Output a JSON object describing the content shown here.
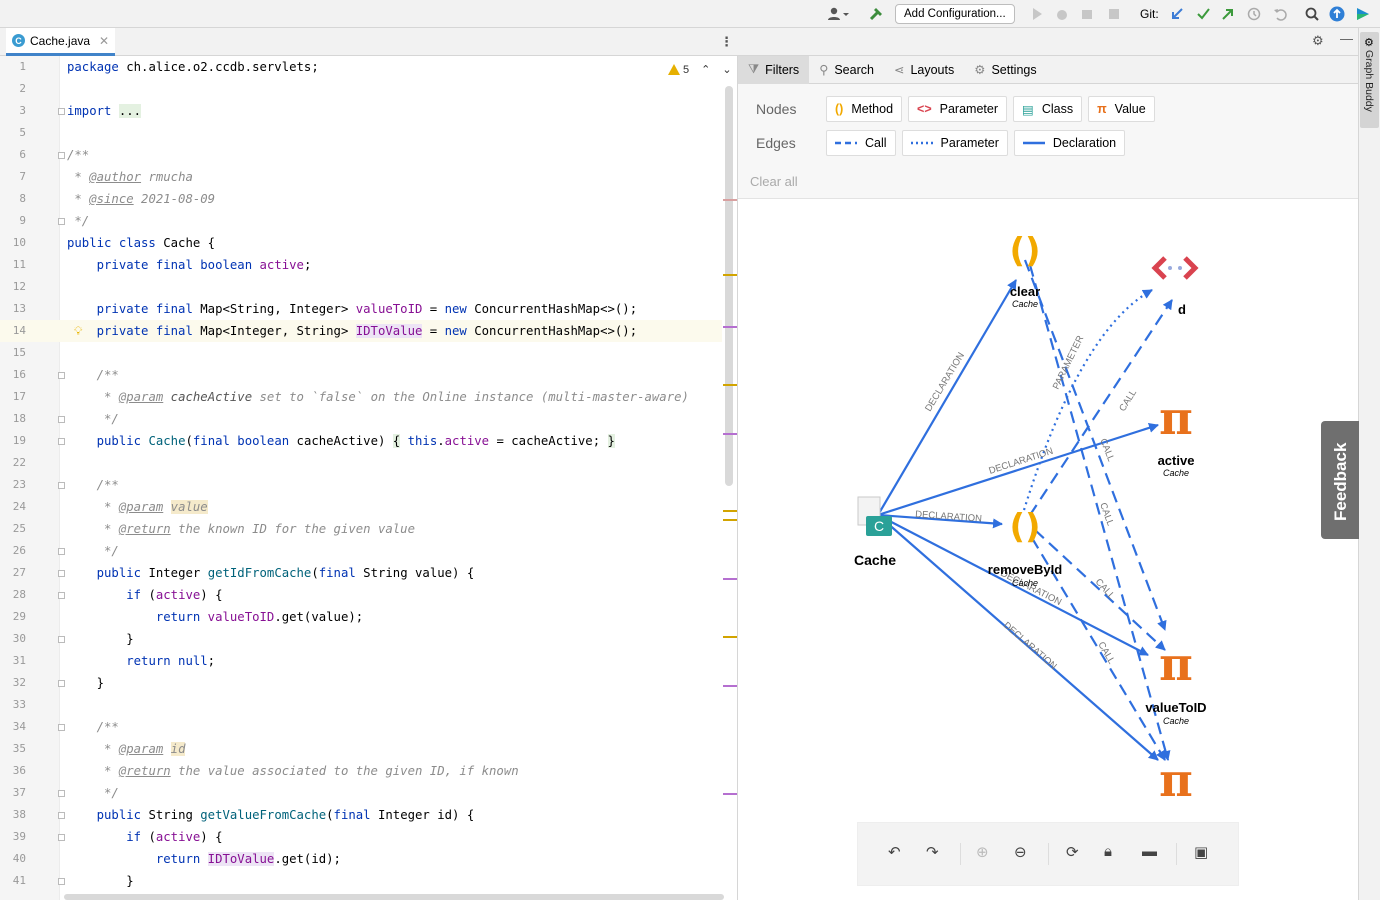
{
  "toolbar": {
    "add_config": "Add Configuration...",
    "git_label": "Git:"
  },
  "editor": {
    "tab_label": "Cache.java",
    "warning_count": "5",
    "lines": [
      {
        "n": "1",
        "html": "<span class=\"kw\">package</span> ch.alice.o2.ccdb.servlets;"
      },
      {
        "n": "2",
        "html": ""
      },
      {
        "n": "3",
        "html": "<span class=\"kw\">import</span> <span style=\"background:#e4f1e1\">...</span>"
      },
      {
        "n": "5",
        "html": ""
      },
      {
        "n": "6",
        "html": "<span class=\"cm\">/**</span>"
      },
      {
        "n": "7",
        "html": "<span class=\"cm\"> * <span class=\"tag\">@author</span> rmucha</span>"
      },
      {
        "n": "8",
        "html": "<span class=\"cm\"> * <span class=\"tag\">@since</span> 2021-08-09</span>"
      },
      {
        "n": "9",
        "html": "<span class=\"cm\"> */</span>"
      },
      {
        "n": "10",
        "html": "<span class=\"kw\">public class</span> Cache {"
      },
      {
        "n": "11",
        "html": "    <span class=\"kw\">private final boolean</span> <span class=\"fld\">active</span>;"
      },
      {
        "n": "12",
        "html": ""
      },
      {
        "n": "13",
        "html": "    <span class=\"kw\">private final</span> Map&lt;String, Integer&gt; <span class=\"fld\">valueToID</span> = <span class=\"kw\">new</span> ConcurrentHashMap&lt;&gt;();"
      },
      {
        "n": "14",
        "html": "    <span class=\"kw\">private final</span> Map&lt;Integer, String&gt; <span class=\"fld\" style=\"background:#ede4f5\">IDToValue</span> = <span class=\"kw\">new</span> ConcurrentHashMap&lt;&gt;();"
      },
      {
        "n": "15",
        "html": ""
      },
      {
        "n": "16",
        "html": "    <span class=\"cm\">/**</span>"
      },
      {
        "n": "17",
        "html": "    <span class=\"cm\"> * <span class=\"tag\">@param</span> <span style=\"color:#555\">cacheActive</span> set to `false` on the Online instance (multi-master-aware)</span>"
      },
      {
        "n": "18",
        "html": "    <span class=\"cm\"> */</span>"
      },
      {
        "n": "19",
        "html": "    <span class=\"kw\">public</span> <span class=\"fn\">Cache</span>(<span class=\"kw\">final boolean</span> cacheActive) <span style=\"background:#e4f1e1\">{</span> <span class=\"kw\">this</span>.<span class=\"fld\">active</span> = cacheActive; <span style=\"background:#e4f1e1\">}</span>"
      },
      {
        "n": "22",
        "html": ""
      },
      {
        "n": "23",
        "html": "    <span class=\"cm\">/**</span>"
      },
      {
        "n": "24",
        "html": "    <span class=\"cm\"> * <span class=\"tag\">@param</span> <span class=\"pm\">value</span></span>"
      },
      {
        "n": "25",
        "html": "    <span class=\"cm\"> * <span class=\"tag\">@return</span> the known ID for the given value</span>"
      },
      {
        "n": "26",
        "html": "    <span class=\"cm\"> */</span>"
      },
      {
        "n": "27",
        "html": "    <span class=\"kw\">public</span> Integer <span class=\"fn\">getIdFromCache</span>(<span class=\"kw\">final</span> String value) {"
      },
      {
        "n": "28",
        "html": "        <span class=\"kw\">if</span> (<span class=\"fld\">active</span>) {"
      },
      {
        "n": "29",
        "html": "            <span class=\"kw\">return</span> <span class=\"fld\">valueToID</span>.get(value);"
      },
      {
        "n": "30",
        "html": "        }"
      },
      {
        "n": "31",
        "html": "        <span class=\"kw\">return null</span>;"
      },
      {
        "n": "32",
        "html": "    }"
      },
      {
        "n": "33",
        "html": ""
      },
      {
        "n": "34",
        "html": "    <span class=\"cm\">/**</span>"
      },
      {
        "n": "35",
        "html": "    <span class=\"cm\"> * <span class=\"tag\">@param</span> <span class=\"pm\">id</span></span>"
      },
      {
        "n": "36",
        "html": "    <span class=\"cm\"> * <span class=\"tag\">@return</span> the value associated to the given ID, if known</span>"
      },
      {
        "n": "37",
        "html": "    <span class=\"cm\"> */</span>"
      },
      {
        "n": "38",
        "html": "    <span class=\"kw\">public</span> String <span class=\"fn\">getValueFromCache</span>(<span class=\"kw\">final</span> Integer id) {"
      },
      {
        "n": "39",
        "html": "        <span class=\"kw\">if</span> (<span class=\"fld\">active</span>) {"
      },
      {
        "n": "40",
        "html": "            <span class=\"kw\">return</span> <span class=\"fld\" style=\"background:#ede4f5\">IDToValue</span>.get(id);"
      },
      {
        "n": "41",
        "html": "        }"
      }
    ]
  },
  "graph_panel": {
    "tabs": [
      "Filters",
      "Search",
      "Layouts",
      "Settings"
    ],
    "nodes_label": "Nodes",
    "edges_label": "Edges",
    "node_filters": [
      "Method",
      "Parameter",
      "Class",
      "Value"
    ],
    "edge_filters": [
      "Call",
      "Parameter",
      "Declaration"
    ],
    "clear_all": "Clear all",
    "side_label": "Graph Buddy",
    "feedback": "Feedback",
    "nodes": {
      "cache": {
        "name": "Cache"
      },
      "clear": {
        "name": "clear",
        "sub": "Cache"
      },
      "id_param": {
        "name": "d"
      },
      "active": {
        "name": "active",
        "sub": "Cache"
      },
      "removeById": {
        "name": "removeById",
        "sub": "Cache"
      },
      "valueToID": {
        "name": "valueToID",
        "sub": "Cache"
      }
    },
    "edge_labels": {
      "declaration": "DECLARATION",
      "call": "CALL",
      "parameter": "PARAMETER"
    },
    "colors": {
      "method": "#f2a900",
      "value": "#e8711c",
      "param": "#d9434f",
      "class": "#2aa198",
      "edge": "#2f6fde"
    }
  }
}
